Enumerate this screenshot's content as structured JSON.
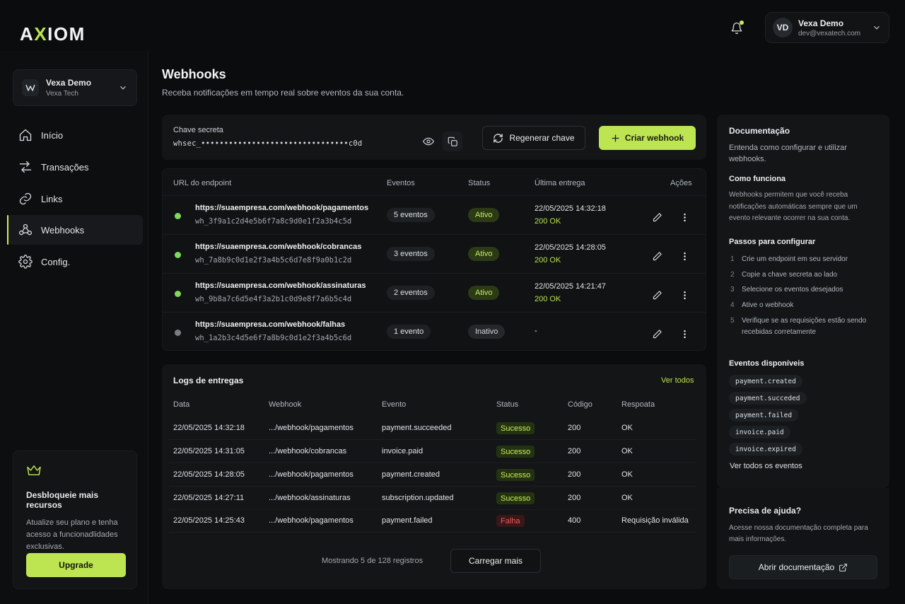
{
  "brand": {
    "name": "AXIOM",
    "prefix": "A",
    "x": "X",
    "suffix": "IOM",
    "accent": "#bde552"
  },
  "user": {
    "initials": "VD",
    "name": "Vexa Demo",
    "email": "dev@vexatech.com"
  },
  "org": {
    "name": "Vexa Demo",
    "company": "Vexa Tech"
  },
  "nav": [
    {
      "label": "Início",
      "icon": "home-icon"
    },
    {
      "label": "Transações",
      "icon": "transactions-icon"
    },
    {
      "label": "Links",
      "icon": "link-icon"
    },
    {
      "label": "Webhooks",
      "icon": "webhook-icon",
      "active": true
    },
    {
      "label": "Config.",
      "icon": "gear-icon"
    }
  ],
  "upgrade": {
    "title": "Desbloqueie mais recursos",
    "description": "Atualize seu plano e tenha acesso a funcionadlidades exclusivas.",
    "button": "Upgrade"
  },
  "page": {
    "title": "Webhooks",
    "subtitle": "Receba notificações em tempo real sobre eventos da sua conta."
  },
  "secret": {
    "label": "Chave secreta",
    "value": "whsec_••••••••••••••••••••••••••••••••c0d"
  },
  "actions": {
    "regenerate": "Regenerar chave",
    "create": "Criar webhook"
  },
  "webhooks": {
    "headers": {
      "url": "URL do endpoint",
      "events": "Eventos",
      "status": "Status",
      "last": "Última entrega",
      "actions": "Ações"
    },
    "rows": [
      {
        "url": "https://suaempresa.com/webhook/pagamentos",
        "id": "wh_3f9a1c2d4e5b6f7a8c9d0e1f2a3b4c5d",
        "events": "5 eventos",
        "status": "Ativo",
        "active": true,
        "last": "22/05/2025 14:32:18",
        "result": "200 OK"
      },
      {
        "url": "https://suaempresa.com/webhook/cobrancas",
        "id": "wh_7a8b9c0d1e2f3a4b5c6d7e8f9a0b1c2d",
        "events": "3 eventos",
        "status": "Ativo",
        "active": true,
        "last": "22/05/2025 14:28:05",
        "result": "200 OK"
      },
      {
        "url": "https://suaempresa.com/webhook/assinaturas",
        "id": "wh_9b8a7c6d5e4f3a2b1c0d9e8f7a6b5c4d",
        "events": "2 eventos",
        "status": "Ativo",
        "active": true,
        "last": "22/05/2025 14:21:47",
        "result": "200 OK"
      },
      {
        "url": "https://suaempresa.com/webhook/falhas",
        "id": "wh_1a2b3c4d5e6f7a8b9c0d1e2f3a4b5c6d",
        "events": "1 evento",
        "status": "Inativo",
        "active": false,
        "last": "-",
        "result": ""
      }
    ]
  },
  "logs": {
    "title": "Logs de entregas",
    "view_all": "Ver todos",
    "headers": {
      "date": "Data",
      "webhook": "Webhook",
      "event": "Evento",
      "status": "Status",
      "code": "Código",
      "response": "Respoata"
    },
    "rows": [
      {
        "date": "22/05/2025 14:32:18",
        "webhook": ".../webhook/pagamentos",
        "event": "payment.succeeded",
        "status": "Sucesso",
        "ok": true,
        "code": "200",
        "response": "OK"
      },
      {
        "date": "22/05/2025 14:31:05",
        "webhook": ".../webhook/cobrancas",
        "event": "invoice.paid",
        "status": "Sucesso",
        "ok": true,
        "code": "200",
        "response": "OK"
      },
      {
        "date": "22/05/2025 14:28:05",
        "webhook": ".../webhook/pagamentos",
        "event": "payment.created",
        "status": "Sucesso",
        "ok": true,
        "code": "200",
        "response": "OK"
      },
      {
        "date": "22/05/2025 14:27:11",
        "webhook": ".../webhook/assinaturas",
        "event": "subscription.updated",
        "status": "Sucesso",
        "ok": true,
        "code": "200",
        "response": "OK"
      },
      {
        "date": "22/05/2025 14:25:43",
        "webhook": ".../webhook/pagamentos",
        "event": "payment.failed",
        "status": "Falha",
        "ok": false,
        "code": "400",
        "response": "Requisição inválida"
      }
    ],
    "count": "Mostrando 5 de 128 registros",
    "load_more": "Carregar mais"
  },
  "docs": {
    "title": "Documentação",
    "description": "Entenda como configurar e utilizar webhooks.",
    "how_title": "Como funciona",
    "how_text": "Webhooks permitem que você receba notificações automáticas sempre que um evento relevante ocorrer na sua conta.",
    "steps_title": "Passos para configurar",
    "steps": [
      "Crie um endpoint em seu servidor",
      "Copie a chave secreta ao lado",
      "Selecione os eventos desejados",
      "Ative o webhook",
      "Verifique se as requisições estão sendo recebidas corretamente"
    ],
    "events_title": "Eventos disponíveis",
    "events": [
      "payment.created",
      "payment.succeded",
      "payment.failed",
      "invoice.paid",
      "invoice.expired"
    ],
    "all_events": "Ver todos os eventos",
    "help_title": "Precisa de ajuda?",
    "help_text": "Acesse nossa documentação completa para mais informações.",
    "help_button": "Abrir documentação"
  }
}
